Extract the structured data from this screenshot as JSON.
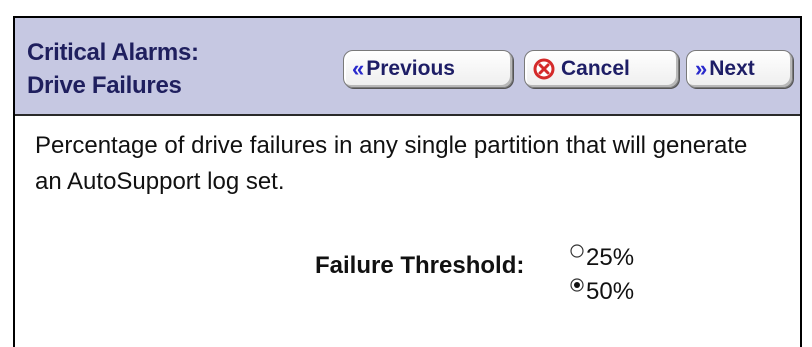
{
  "header": {
    "title_line1": "Critical Alarms:",
    "title_line2": "Drive Failures",
    "buttons": {
      "previous": "Previous",
      "cancel": "Cancel",
      "next": "Next"
    }
  },
  "content": {
    "description": "Percentage of drive failures in any single partition that will generate an AutoSupport log set.",
    "threshold_label": "Failure Threshold:",
    "options": [
      {
        "label": "25%",
        "selected": false
      },
      {
        "label": "50%",
        "selected": true
      }
    ]
  },
  "colors": {
    "header_bg": "#c6c8e2",
    "title_color": "#1f1f5e",
    "cancel_icon": "#d42a2a"
  },
  "icons": {
    "previous": "double-chevron-left-icon",
    "cancel": "cancel-circle-icon",
    "next": "double-chevron-right-icon"
  }
}
